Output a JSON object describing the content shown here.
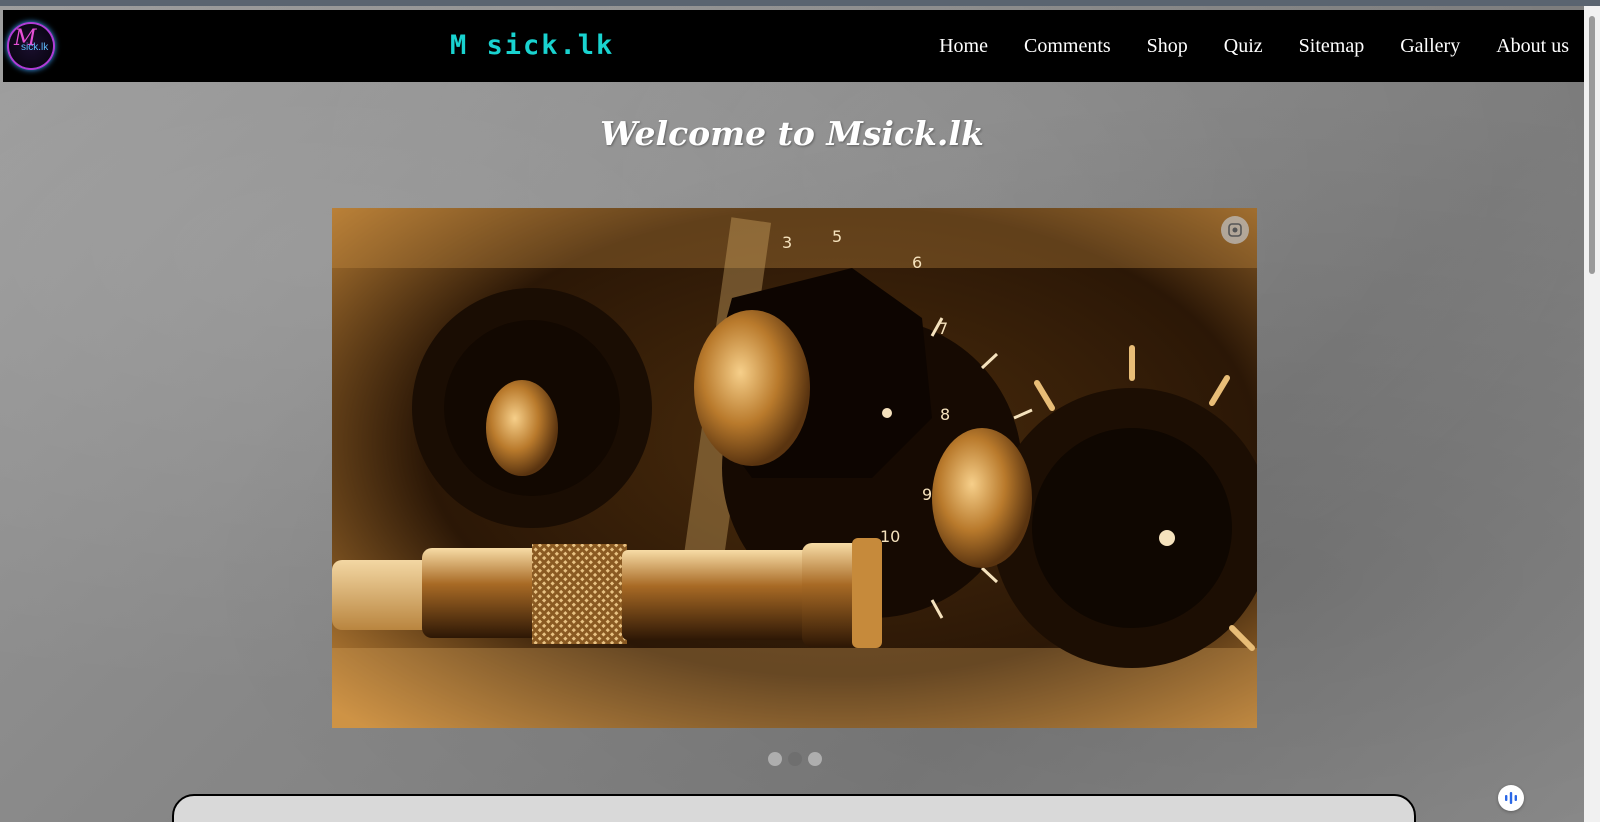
{
  "header": {
    "logo_text_big": "M",
    "logo_text_small": "sick.lk",
    "brand": "M sick.lk",
    "nav": [
      {
        "label": "Home"
      },
      {
        "label": "Comments"
      },
      {
        "label": "Shop"
      },
      {
        "label": "Quiz"
      },
      {
        "label": "Sitemap"
      },
      {
        "label": "Gallery"
      },
      {
        "label": "About us"
      }
    ]
  },
  "main": {
    "welcome": "Welcome to Msick.lk",
    "slider": {
      "image_icon": "audio-amplifier-knobs-photo",
      "active_dot": 1,
      "dot_count": 3
    }
  },
  "colors": {
    "navbar_bg": "#000000",
    "brand": "#19d3d0",
    "nav_text": "#ffffff",
    "card_bg": "#d9d9d9"
  },
  "icons": {
    "lens": "lens-icon",
    "fab": "voice-assistant-icon"
  }
}
